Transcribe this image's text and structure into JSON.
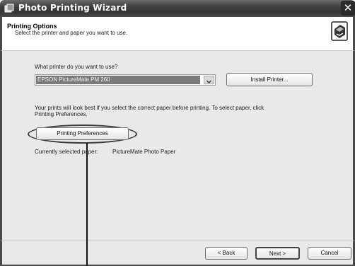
{
  "window": {
    "title": "Photo Printing Wizard",
    "close_label": "✕"
  },
  "header": {
    "title": "Printing Options",
    "subtitle": "Select the printer and paper you want to use."
  },
  "content": {
    "printer_question": "What printer do you want to use?",
    "printer_selected": "EPSON PictureMate PM 260",
    "install_button": "Install Printer...",
    "info_line1": "Your prints will look best if you select the correct paper before printing. To select paper, click",
    "info_line2": "Printing Preferences.",
    "preferences_button": "Printing Preferences",
    "paper_label": "Currently selected paper:",
    "paper_value": "PictureMate Photo Paper"
  },
  "footer": {
    "back_label": "< Back",
    "next_label": "Next >",
    "cancel_label": "Cancel"
  },
  "icons": {
    "app": "photo-wizard-icon",
    "wizard": "printer-wizard-icon",
    "dropdown": "chevron-down-icon"
  }
}
